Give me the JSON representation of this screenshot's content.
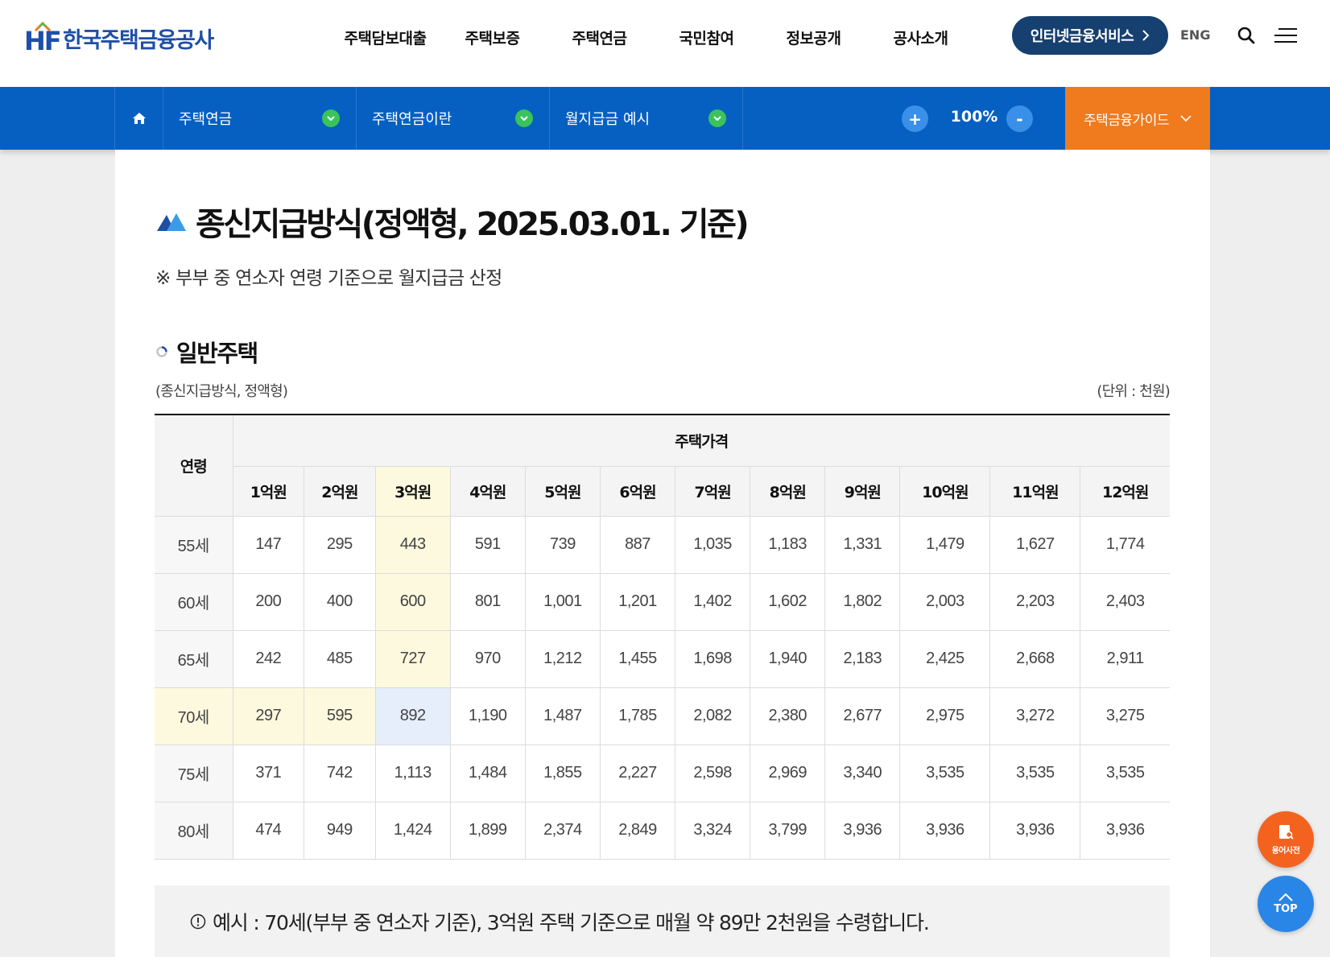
{
  "header": {
    "logo_mark": "HF",
    "logo_text": "한국주택금융공사",
    "nav": [
      "주택담보대출",
      "주택보증",
      "주택연금",
      "국민참여",
      "정보공개",
      "공사소개"
    ],
    "internet_service": "인터넷금융서비스",
    "eng": "ENG"
  },
  "navbar": {
    "crumbs": [
      "주택연금",
      "주택연금이란",
      "월지급금 예시"
    ],
    "zoom_value": "100%",
    "zoom_plus": "+",
    "zoom_minus": "-",
    "guide": "주택금융가이드"
  },
  "content": {
    "title": "종신지급방식(정액형, 2025.03.01. 기준)",
    "note": "※ 부부 중 연소자 연령 기준으로 월지급금 산정",
    "section_title": "일반주택",
    "caption_left": "(종신지급방식, 정액형)",
    "caption_right": "(단위 : 천원)",
    "table": {
      "age_header": "연령",
      "price_header": "주택가격",
      "price_columns": [
        "1억원",
        "2억원",
        "3억원",
        "4억원",
        "5억원",
        "6억원",
        "7억원",
        "8억원",
        "9억원",
        "10억원",
        "11억원",
        "12억원"
      ],
      "rows": [
        {
          "age": "55세",
          "values": [
            "147",
            "295",
            "443",
            "591",
            "739",
            "887",
            "1,035",
            "1,183",
            "1,331",
            "1,479",
            "1,627",
            "1,774"
          ]
        },
        {
          "age": "60세",
          "values": [
            "200",
            "400",
            "600",
            "801",
            "1,001",
            "1,201",
            "1,402",
            "1,602",
            "1,802",
            "2,003",
            "2,203",
            "2,403"
          ]
        },
        {
          "age": "65세",
          "values": [
            "242",
            "485",
            "727",
            "970",
            "1,212",
            "1,455",
            "1,698",
            "1,940",
            "2,183",
            "2,425",
            "2,668",
            "2,911"
          ]
        },
        {
          "age": "70세",
          "values": [
            "297",
            "595",
            "892",
            "1,190",
            "1,487",
            "1,785",
            "2,082",
            "2,380",
            "2,677",
            "2,975",
            "3,272",
            "3,275"
          ]
        },
        {
          "age": "75세",
          "values": [
            "371",
            "742",
            "1,113",
            "1,484",
            "1,855",
            "2,227",
            "2,598",
            "2,969",
            "3,340",
            "3,535",
            "3,535",
            "3,535"
          ]
        },
        {
          "age": "80세",
          "values": [
            "474",
            "949",
            "1,424",
            "1,899",
            "2,374",
            "2,849",
            "3,324",
            "3,799",
            "3,936",
            "3,936",
            "3,936",
            "3,936"
          ]
        }
      ]
    },
    "example": "예시 : 70세(부부 중 연소자 기준), 3억원 주택 기준으로 매월 약 89만 2천원을 수령합니다."
  },
  "floating": {
    "dictionary": "용어사전",
    "top": "TOP"
  },
  "colors": {
    "brand_blue": "#1e4fa8",
    "nav_blue": "#0560c2",
    "accent_orange": "#f07a1e",
    "highlight_yellow": "#fdf9de",
    "highlight_cross": "#e6eefc"
  }
}
